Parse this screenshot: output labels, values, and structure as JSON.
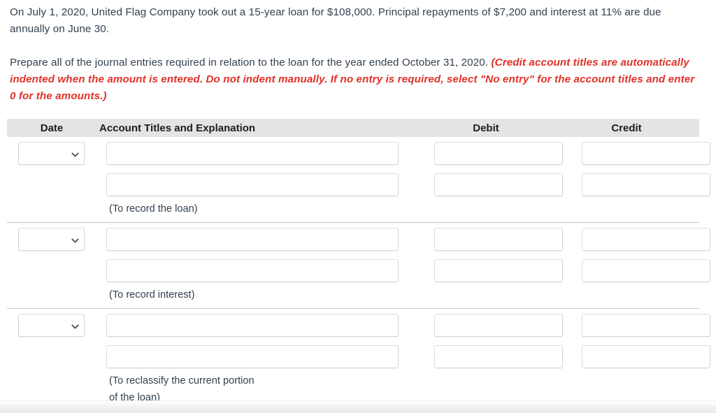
{
  "problem": {
    "paragraph1": "On July 1, 2020, United Flag Company took out a 15-year loan for $108,000. Principal repayments of $7,200 and interest at 11% are due annually on June 30.",
    "paragraph2_plain": "Prepare all of the journal entries required in relation to the loan for the year ended October 31, 2020. ",
    "paragraph2_note": "(Credit account titles are automatically indented when the amount is entered. Do not indent manually. If no entry is required, select \"No entry\" for the account titles and enter 0 for the amounts.)",
    "note_color": "#e03127"
  },
  "table": {
    "headers": {
      "date": "Date",
      "account": "Account Titles and Explanation",
      "debit": "Debit",
      "credit": "Credit"
    },
    "entries": [
      {
        "date_value": "",
        "date_placeholder": "",
        "rows": [
          {
            "account": "",
            "debit": "",
            "credit": ""
          },
          {
            "account": "",
            "debit": "",
            "credit": ""
          }
        ],
        "caption": "(To record the loan)"
      },
      {
        "date_value": "",
        "date_placeholder": "",
        "rows": [
          {
            "account": "",
            "debit": "",
            "credit": ""
          },
          {
            "account": "",
            "debit": "",
            "credit": ""
          }
        ],
        "caption": "(To record interest)"
      },
      {
        "date_value": "",
        "date_placeholder": "",
        "rows": [
          {
            "account": "",
            "debit": "",
            "credit": ""
          },
          {
            "account": "",
            "debit": "",
            "credit": ""
          }
        ],
        "caption": "(To reclassify the current portion of the loan)"
      }
    ]
  },
  "icons": {
    "chevron": "chevron-down-icon"
  }
}
